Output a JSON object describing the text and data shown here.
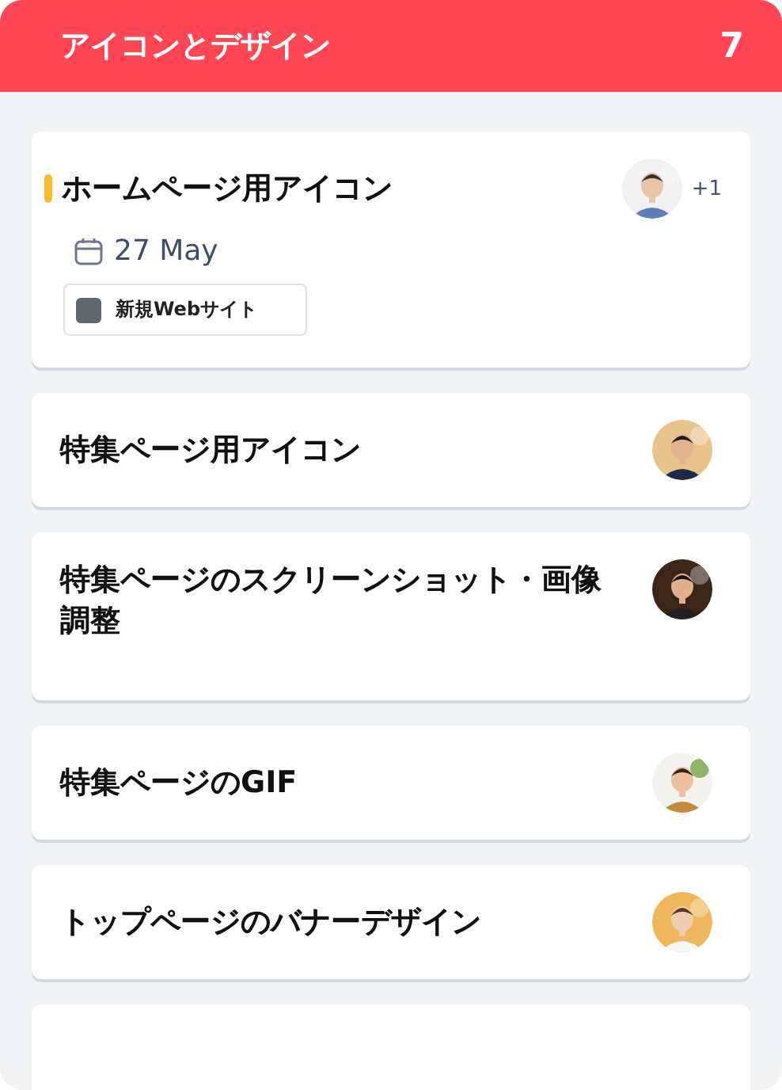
{
  "column": {
    "title": "アイコンとデザイン",
    "count": "7"
  },
  "tasks": [
    {
      "title": "ホームページ用アイコン",
      "color": "#fbbb2d",
      "due": "27 May",
      "tags": [
        {
          "label": "新規Webサイト",
          "color": "#62666d"
        }
      ],
      "extra_assignees": "+1"
    },
    {
      "title": "特集ページ用アイコン"
    },
    {
      "title": "特集ページのスクリーンショット・画像調整"
    },
    {
      "title": "特集ページのGIF"
    },
    {
      "title": "トップページのバナーデザイン"
    }
  ],
  "partial_card": true
}
